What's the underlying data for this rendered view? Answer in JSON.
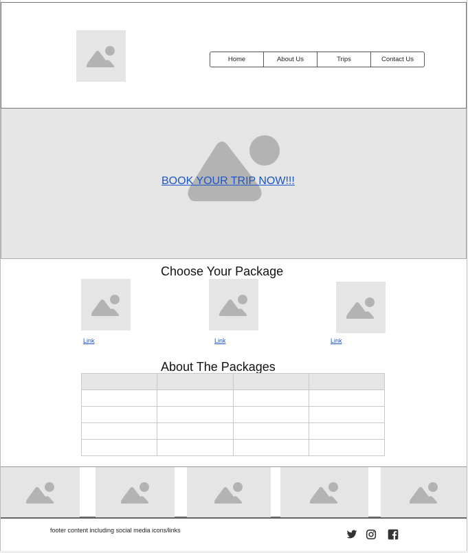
{
  "nav": {
    "items": [
      {
        "label": "Home"
      },
      {
        "label": "About Us"
      },
      {
        "label": "Trips"
      },
      {
        "label": "Contact Us"
      }
    ]
  },
  "hero": {
    "link_text": "BOOK YOUR TRIP NOW!!!"
  },
  "packages": {
    "title": "Choose Your Package",
    "items": [
      {
        "link": "Link"
      },
      {
        "link": "Link"
      },
      {
        "link": "Link"
      }
    ]
  },
  "about": {
    "title": "About The Packages",
    "rows": [
      [
        "",
        "",
        "",
        ""
      ],
      [
        "",
        "",
        "",
        ""
      ],
      [
        "",
        "",
        "",
        ""
      ],
      [
        "",
        "",
        "",
        ""
      ],
      [
        "",
        "",
        "",
        ""
      ]
    ]
  },
  "footer": {
    "text": "footer content including social media icons/links",
    "social_icons": [
      "twitter-icon",
      "instagram-icon",
      "facebook-icon"
    ]
  },
  "colors": {
    "placeholder": "#e5e5e5",
    "placeholder_icon": "#b3b3b3",
    "link": "#1a56c6"
  }
}
